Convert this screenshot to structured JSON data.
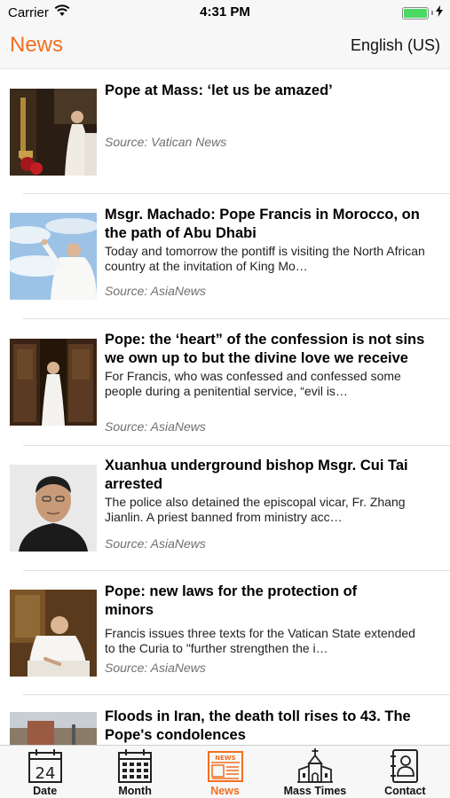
{
  "status_bar": {
    "carrier": "Carrier",
    "time": "4:31 PM",
    "battery_level": 1.0
  },
  "nav": {
    "title": "News",
    "language": "English (US)"
  },
  "articles": [
    {
      "title": "Pope at Mass: ‘let us be amazed’",
      "summary": "",
      "source": "Source: Vatican News"
    },
    {
      "title": "Msgr. Machado: Pope Francis in Morocco, on the path of Abu Dhabi",
      "summary": "Today and tomorrow the pontiff is visiting the North African country at the invitation of King Mo…",
      "source": "Source: AsiaNews"
    },
    {
      "title": "Pope: the ‘heart” of the confession is not sins we own up to but the divine love we receive",
      "summary": "For Francis, who was confessed and confessed some people during a penitential service, “evil is…",
      "source": "Source: AsiaNews"
    },
    {
      "title": "Xuanhua underground bishop Msgr. Cui Tai arrested",
      "summary": "The police also detained the episcopal vicar, Fr. Zhang Jianlin. A priest banned from ministry acc…",
      "source": "Source: AsiaNews"
    },
    {
      "title": "Pope: new laws for the protection of minors",
      "summary": "Francis issues three texts for the Vatican State extended to the Curia to \"further strengthen the i…",
      "source": "Source: AsiaNews"
    },
    {
      "title": "Floods in Iran, the death toll rises to 43. The Pope's condolences",
      "summary": "",
      "source": ""
    }
  ],
  "tabs": [
    {
      "label": "Date",
      "icon": "calendar-date-icon",
      "day": "24"
    },
    {
      "label": "Month",
      "icon": "calendar-month-icon"
    },
    {
      "label": "News",
      "icon": "newspaper-icon",
      "badge": "NEWS"
    },
    {
      "label": "Mass Times",
      "icon": "church-icon"
    },
    {
      "label": "Contact",
      "icon": "contact-book-icon"
    }
  ],
  "colors": {
    "accent": "#f26f21",
    "source_text": "#707070",
    "bar_background": "#f7f7f7",
    "battery": "#4cd964"
  }
}
